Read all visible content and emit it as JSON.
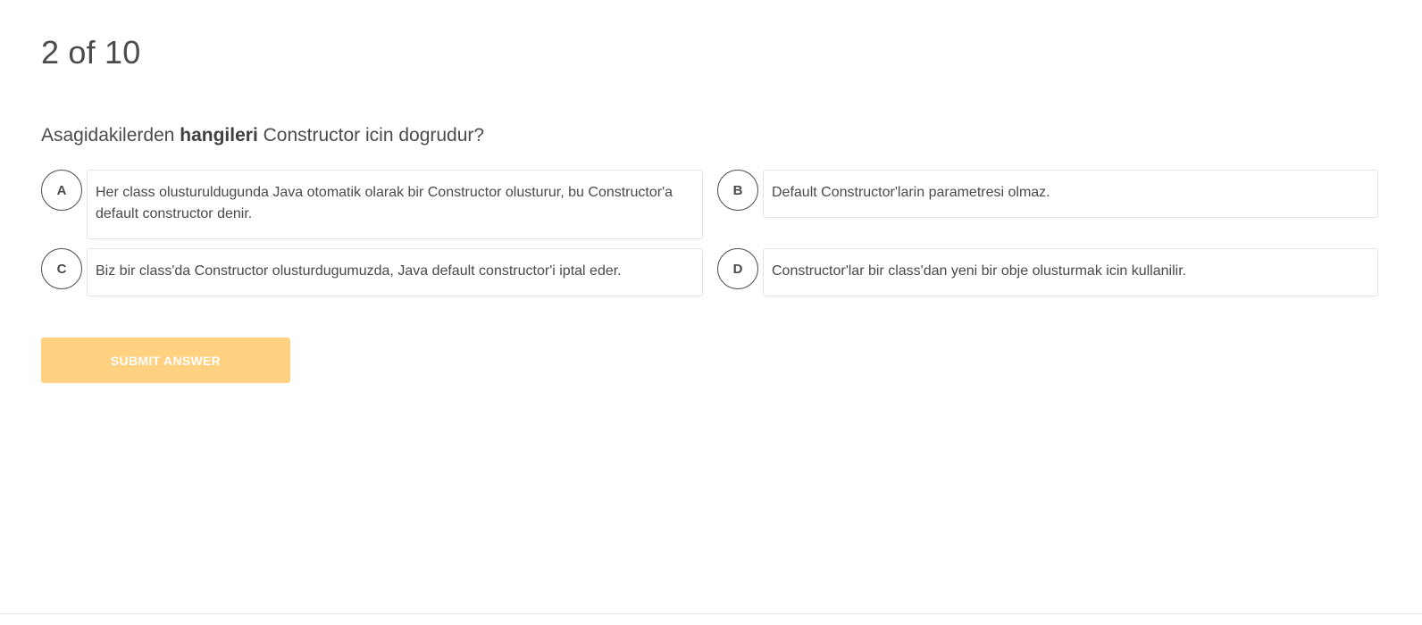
{
  "quiz": {
    "progress": "2 of 10",
    "question": {
      "before": "Asagidakilerden ",
      "bold": "hangileri",
      "after": " Constructor icin dogrudur?"
    },
    "options": [
      {
        "letter": "A",
        "text": "Her class olusturuldugunda Java otomatik olarak bir Constructor olusturur, bu Constructor'a default constructor denir."
      },
      {
        "letter": "B",
        "text": "Default Constructor'larin parametresi olmaz."
      },
      {
        "letter": "C",
        "text": "Biz bir class'da Constructor olusturdugumuzda, Java default constructor'i iptal eder."
      },
      {
        "letter": "D",
        "text": "Constructor'lar bir class'dan yeni bir obje olusturmak icin kullanilir."
      }
    ],
    "submit_label": "SUBMIT ANSWER",
    "colors": {
      "submit_bg": "#ffd180",
      "option_border": "#dfe6ea",
      "text": "#4a4a4a"
    }
  }
}
